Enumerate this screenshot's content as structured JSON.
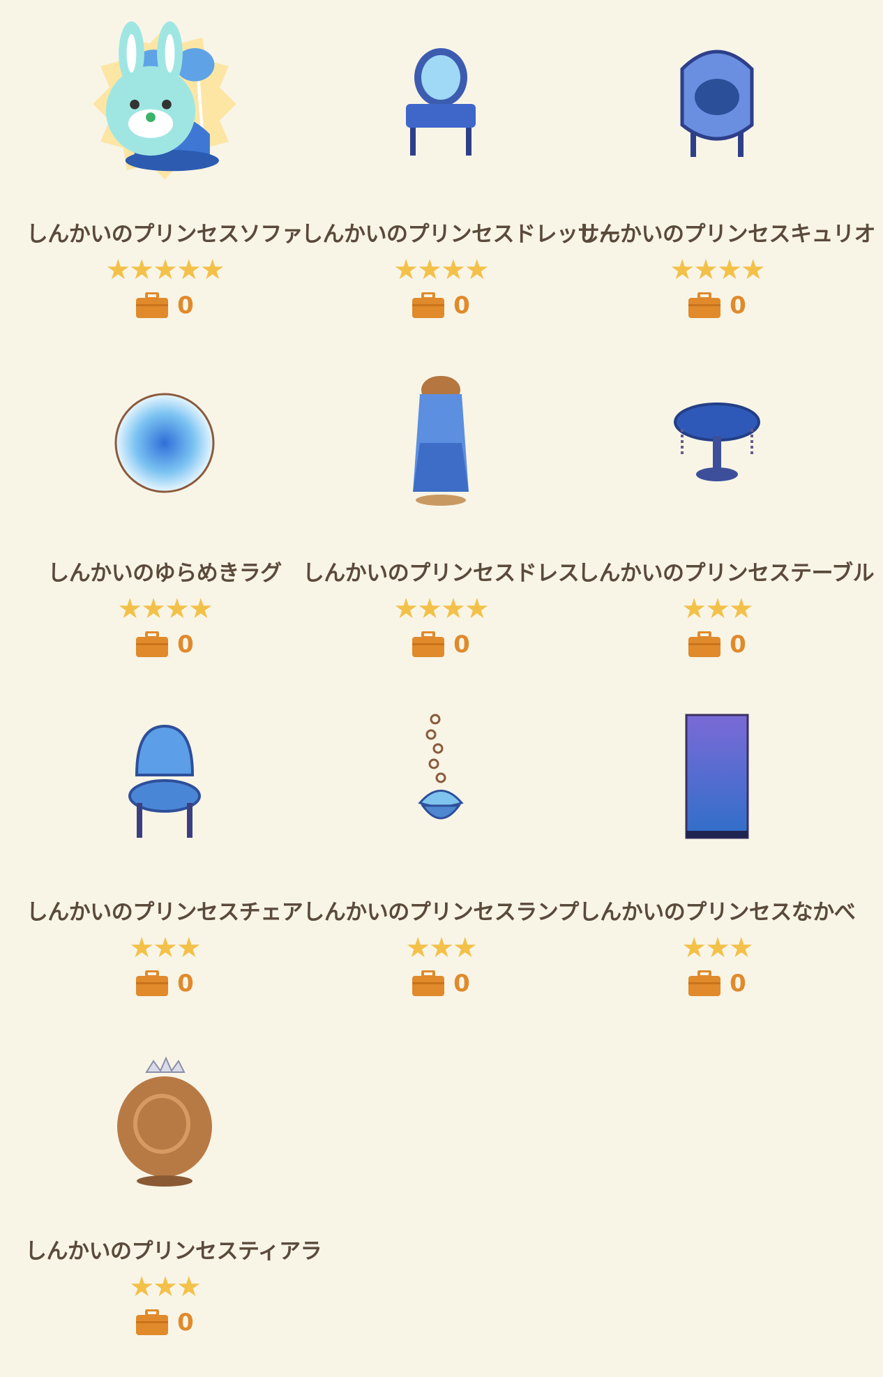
{
  "accent": "#e08a2c",
  "star_color": "#f3c14a",
  "items": [
    {
      "name": "しんかいのプリンセスソファ",
      "stars": "★★★★★",
      "count": "0",
      "icon": "shell-sofa-icon",
      "badge": true
    },
    {
      "name": "しんかいのプリンセスドレッサー",
      "stars": "★★★★",
      "count": "0",
      "icon": "dresser-icon"
    },
    {
      "name": "しんかいのプリンセスキュリオ",
      "stars": "★★★★",
      "count": "0",
      "icon": "curio-cabinet-icon"
    },
    {
      "name": "しんかいのゆらめきラグ",
      "stars": "★★★★",
      "count": "0",
      "icon": "round-rug-icon"
    },
    {
      "name": "しんかいのプリンセスドレス",
      "stars": "★★★★",
      "count": "0",
      "icon": "dress-mannequin-icon"
    },
    {
      "name": "しんかいのプリンセステーブル",
      "stars": "★★★",
      "count": "0",
      "icon": "round-table-icon"
    },
    {
      "name": "しんかいのプリンセスチェア",
      "stars": "★★★",
      "count": "0",
      "icon": "shell-chair-icon"
    },
    {
      "name": "しんかいのプリンセスランプ",
      "stars": "★★★",
      "count": "0",
      "icon": "shell-lamp-icon"
    },
    {
      "name": "しんかいのプリンセスなかべ",
      "stars": "★★★",
      "count": "0",
      "icon": "wall-panel-icon"
    },
    {
      "name": "しんかいのプリンセスティアラ",
      "stars": "★★★",
      "count": "0",
      "icon": "tiara-icon"
    }
  ]
}
